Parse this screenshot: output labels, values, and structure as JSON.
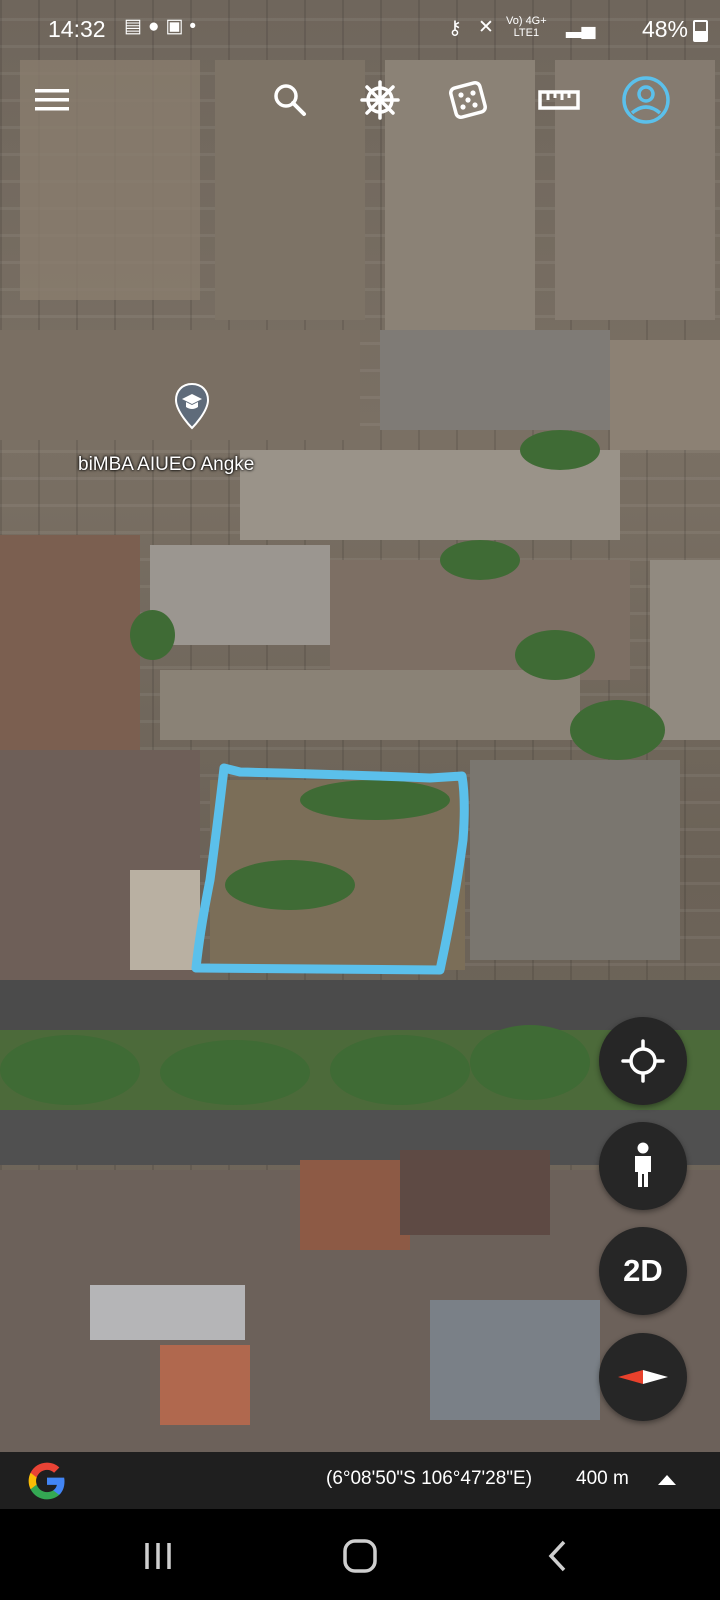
{
  "status_bar": {
    "time": "14:32",
    "network": "Vo) 4G+",
    "network_sub": "LTE1",
    "battery": "48%"
  },
  "toolbar": {
    "icons": [
      "menu-icon",
      "search-icon",
      "voyager-wheel-icon",
      "dice-icon",
      "ruler-icon",
      "account-icon"
    ]
  },
  "map": {
    "place_label": "biMBA AIUEO Angke",
    "outline_color": "#5bc0eb"
  },
  "controls": {
    "view_mode": "2D"
  },
  "bottom_bar": {
    "coordinates": "(6°08'50\"S 106°47'28\"E)",
    "scale": "400 m"
  },
  "colors": {
    "accent": "#5bc0eb",
    "fab_bg": "#262626",
    "compass_red": "#e8412c"
  }
}
